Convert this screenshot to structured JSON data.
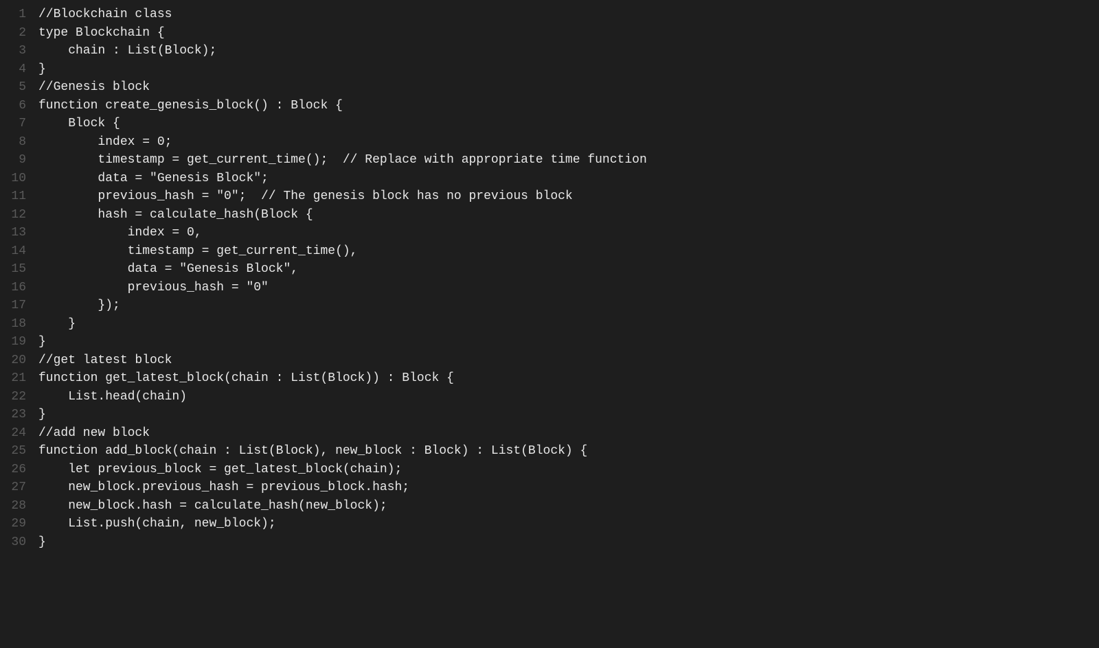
{
  "editor": {
    "lineStart": 1,
    "lines": [
      "//Blockchain class",
      "type Blockchain {",
      "    chain : List(Block);",
      "}",
      "//Genesis block",
      "function create_genesis_block() : Block {",
      "    Block {",
      "        index = 0;",
      "        timestamp = get_current_time();  // Replace with appropriate time function",
      "        data = \"Genesis Block\";",
      "        previous_hash = \"0\";  // The genesis block has no previous block",
      "        hash = calculate_hash(Block {",
      "            index = 0,",
      "            timestamp = get_current_time(),",
      "            data = \"Genesis Block\",",
      "            previous_hash = \"0\"",
      "        });",
      "    }",
      "}",
      "//get latest block",
      "function get_latest_block(chain : List(Block)) : Block {",
      "    List.head(chain)",
      "}",
      "//add new block",
      "function add_block(chain : List(Block), new_block : Block) : List(Block) {",
      "    let previous_block = get_latest_block(chain);",
      "    new_block.previous_hash = previous_block.hash;",
      "    new_block.hash = calculate_hash(new_block);",
      "    List.push(chain, new_block);",
      "}"
    ]
  }
}
